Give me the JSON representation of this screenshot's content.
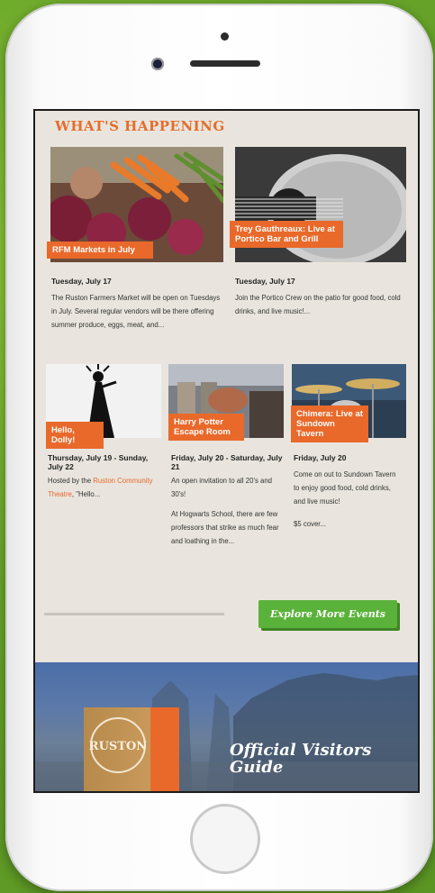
{
  "heading": "WHAT'S HAPPENING",
  "events_top": [
    {
      "tag": "RFM Markets in July",
      "date": "Tuesday, July 17",
      "body": "The Ruston Farmers Market will be open on Tuesdays in July. Several regular vendors will be there offering summer produce, eggs, meat, and..."
    },
    {
      "tag": "Trey Gauthreaux: Live at Portico Bar and Grill",
      "date": "Tuesday, July 17",
      "body": "Join the Portico Crew on the patio for good food, cold drinks, and live music!..."
    }
  ],
  "events_bottom": [
    {
      "tag": "Hello, Dolly!",
      "date": "Thursday, July 19 - Sunday, July 22",
      "body_prefix": "Hosted by the ",
      "body_link": "Ruston Community Theatre",
      "body_suffix": ", \"Hello..."
    },
    {
      "tag": "Harry Potter Escape Room",
      "date": "Friday, July 20 - Saturday, July 21",
      "body": "An open invitation to all 20's and 30's!",
      "body2": "At Hogwarts School, there are few professors that strike as much fear and loathing in the..."
    },
    {
      "tag": "Chimera: Live at Sundown Tavern",
      "date": "Friday, July 20",
      "body": "Come on out to Sundown Tavern to enjoy good food, cold drinks, and live music!",
      "body2": "$5 cover..."
    }
  ],
  "explore_button": "Explore More Events",
  "guide": {
    "book_label": "RUSTON",
    "title": "Official Visitors Guide"
  },
  "colors": {
    "accent": "#e8692a",
    "button": "#5ab23a",
    "background": "#e9e5de"
  }
}
